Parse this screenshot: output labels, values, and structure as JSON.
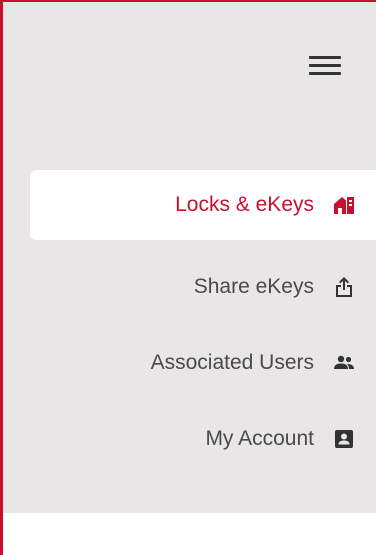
{
  "colors": {
    "accent": "#c8102e",
    "sidebar_bg": "#e8e6e6",
    "text": "#4a4a4a",
    "icon": "#333333"
  },
  "menu_toggle": {
    "icon": "hamburger-menu-icon"
  },
  "nav": {
    "items": [
      {
        "label": "Locks & eKeys",
        "icon": "house-lock-icon",
        "active": true
      },
      {
        "label": "Share eKeys",
        "icon": "share-upload-icon",
        "active": false
      },
      {
        "label": "Associated Users",
        "icon": "users-icon",
        "active": false
      },
      {
        "label": "My Account",
        "icon": "account-card-icon",
        "active": false
      }
    ]
  }
}
